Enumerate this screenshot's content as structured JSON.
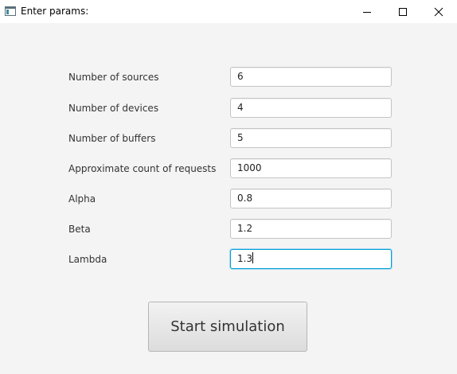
{
  "window": {
    "title": "Enter params:",
    "controls": {
      "minimize_icon": "minimize-icon",
      "maximize_icon": "maximize-icon",
      "close_icon": "close-icon"
    }
  },
  "form": {
    "fields": [
      {
        "label": "Number of sources",
        "value": "6"
      },
      {
        "label": "Number of devices",
        "value": "4"
      },
      {
        "label": "Number of buffers",
        "value": "5"
      },
      {
        "label": "Approximate count of requests",
        "value": "1000"
      },
      {
        "label": "Alpha",
        "value": "0.8"
      },
      {
        "label": "Beta",
        "value": "1.2"
      },
      {
        "label": "Lambda",
        "value": "1.3"
      }
    ],
    "submit_label": "Start simulation"
  },
  "colors": {
    "focus_border": "#039ed3",
    "background": "#f4f4f4"
  }
}
